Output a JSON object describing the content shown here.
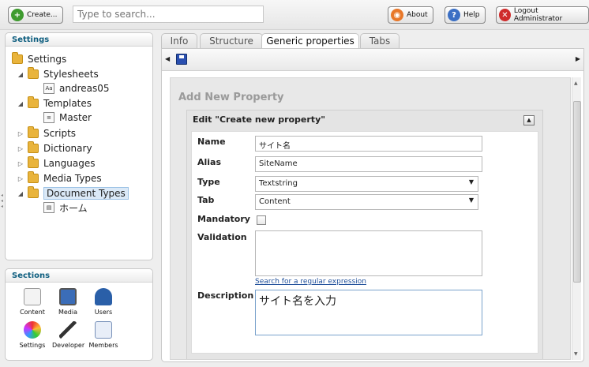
{
  "topbar": {
    "create_label": "Create...",
    "search_placeholder": "Type to search...",
    "about_label": "About",
    "help_label": "Help",
    "logout_label": "Logout Administrator"
  },
  "settings_panel": {
    "title": "Settings",
    "tree": {
      "root": "Settings",
      "stylesheets": "Stylesheets",
      "stylesheet_child": "andreas05",
      "templates": "Templates",
      "template_child": "Master",
      "scripts": "Scripts",
      "dictionary": "Dictionary",
      "languages": "Languages",
      "media_types": "Media Types",
      "document_types": "Document Types",
      "document_type_child": "ホーム"
    }
  },
  "sections_panel": {
    "title": "Sections",
    "items": [
      "Content",
      "Media",
      "Users",
      "Settings",
      "Developer",
      "Members"
    ]
  },
  "tabs": [
    "Info",
    "Structure",
    "Generic properties",
    "Tabs"
  ],
  "active_tab": "Generic properties",
  "editor": {
    "section_title": "Add New Property",
    "box_title": "Edit \"Create new property\"",
    "labels": {
      "name": "Name",
      "alias": "Alias",
      "type": "Type",
      "tab": "Tab",
      "mandatory": "Mandatory",
      "validation": "Validation",
      "description": "Description"
    },
    "values": {
      "name": "サイト名",
      "alias": "SiteName",
      "type": "Textstring",
      "tab": "Content",
      "validation": "",
      "description": "サイト名を入力"
    },
    "regex_link": "Search for a regular expression"
  },
  "colors": {
    "panel_title": "#0e5e7f",
    "link": "#1f4f9a",
    "create_icon": "#3f9b2f",
    "about_icon": "#e8782a",
    "help_icon": "#3b6fc4",
    "logout_icon": "#cf2b2b",
    "save_icon": "#2a4fb0"
  },
  "icons": [
    "plus-icon",
    "info-icon",
    "question-icon",
    "logout-icon",
    "save-icon",
    "folder-icon",
    "stylesheet-icon",
    "template-icon",
    "collapse-icon"
  ]
}
